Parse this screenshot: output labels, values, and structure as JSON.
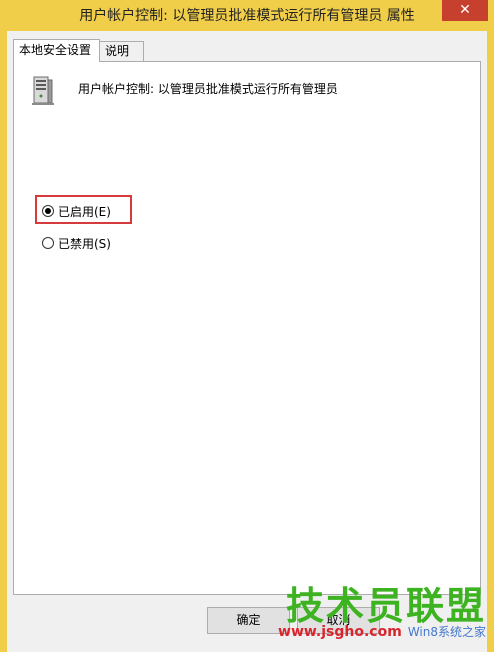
{
  "window": {
    "title": "用户帐户控制: 以管理员批准模式运行所有管理员 属性",
    "close_glyph": "✕"
  },
  "tabs": [
    {
      "label": "本地安全设置",
      "active": true
    },
    {
      "label": "说明",
      "active": false
    }
  ],
  "policy": {
    "icon": "server-icon",
    "name": "用户帐户控制: 以管理员批准模式运行所有管理员"
  },
  "options": {
    "enabled": {
      "label": "已启用(E)",
      "checked": true
    },
    "disabled": {
      "label": "已禁用(S)",
      "checked": false
    }
  },
  "buttons": {
    "ok": "确定",
    "cancel": "取消"
  },
  "watermark": {
    "main": "技术员联盟",
    "url": "www.jsgho.com",
    "sub": "Win8系统之家"
  },
  "colors": {
    "title_bar": "#f0ce4a",
    "close_button": "#c7402e",
    "highlight": "#d63a3a",
    "watermark_green": "#3db321",
    "watermark_red": "#d8262d"
  }
}
